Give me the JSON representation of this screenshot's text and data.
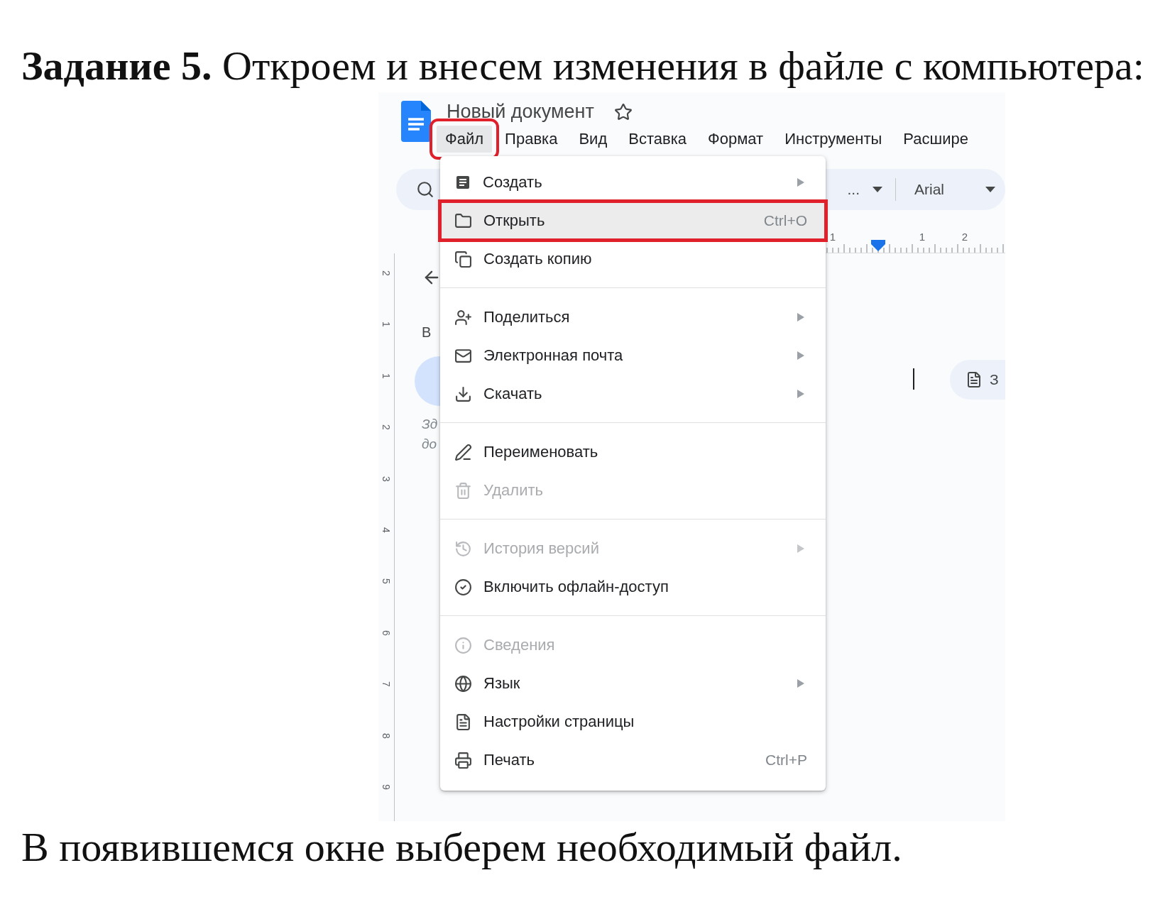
{
  "task": {
    "heading": "**Задание 5.** Откроем и внесем изменения в файле с компьютера:",
    "footer": "В появившемся окне выберем необходимый файл."
  },
  "screenshot": {
    "document_title": "Новый документ",
    "menu_bar": [
      {
        "label": "Файл",
        "selected": true,
        "outlined": true
      },
      {
        "label": "Правка",
        "selected": false,
        "outlined": false
      },
      {
        "label": "Вид",
        "selected": false,
        "outlined": false
      },
      {
        "label": "Вставка",
        "selected": false,
        "outlined": false
      },
      {
        "label": "Формат",
        "selected": false,
        "outlined": false
      },
      {
        "label": "Инструменты",
        "selected": false,
        "outlined": false
      },
      {
        "label": "Расшире",
        "selected": false,
        "outlined": false
      }
    ],
    "toolbar": {
      "style_dropdown": "...",
      "font_dropdown": "Arial"
    },
    "ruler_horizontal": [
      "1",
      "1",
      "2"
    ],
    "ruler_vertical": [
      "2",
      "1",
      "1",
      "2",
      "3",
      "4",
      "5",
      "6",
      "7",
      "8",
      "9"
    ],
    "outline_panel": {
      "heading": "В",
      "hint_lines": [
        "Зд",
        "до"
      ]
    },
    "chip": {
      "label": "З"
    },
    "file_menu": [
      {
        "kind": "item",
        "label": "Создать",
        "submenu": true,
        "disabled": false,
        "selected": false,
        "outlined": false
      },
      {
        "kind": "item",
        "label": "Открыть",
        "shortcut": "Ctrl+O",
        "submenu": false,
        "disabled": false,
        "selected": true,
        "outlined": true
      },
      {
        "kind": "item",
        "label": "Создать копию",
        "submenu": false,
        "disabled": false,
        "selected": false,
        "outlined": false
      },
      {
        "kind": "separator"
      },
      {
        "kind": "item",
        "label": "Поделиться",
        "submenu": true,
        "disabled": false,
        "selected": false,
        "outlined": false
      },
      {
        "kind": "item",
        "label": "Электронная почта",
        "submenu": true,
        "disabled": false,
        "selected": false,
        "outlined": false
      },
      {
        "kind": "item",
        "label": "Скачать",
        "submenu": true,
        "disabled": false,
        "selected": false,
        "outlined": false
      },
      {
        "kind": "separator"
      },
      {
        "kind": "item",
        "label": "Переименовать",
        "submenu": false,
        "disabled": false,
        "selected": false,
        "outlined": false
      },
      {
        "kind": "item",
        "label": "Удалить",
        "submenu": false,
        "disabled": true,
        "selected": false,
        "outlined": false
      },
      {
        "kind": "separator"
      },
      {
        "kind": "item",
        "label": "История версий",
        "submenu": true,
        "disabled": true,
        "selected": false,
        "outlined": false
      },
      {
        "kind": "item",
        "label": "Включить офлайн-доступ",
        "submenu": false,
        "disabled": false,
        "selected": false,
        "outlined": false
      },
      {
        "kind": "separator"
      },
      {
        "kind": "item",
        "label": "Сведения",
        "submenu": false,
        "disabled": true,
        "selected": false,
        "outlined": false
      },
      {
        "kind": "item",
        "label": "Язык",
        "submenu": true,
        "disabled": false,
        "selected": false,
        "outlined": false
      },
      {
        "kind": "item",
        "label": "Настройки страницы",
        "submenu": false,
        "disabled": false,
        "selected": false,
        "outlined": false
      },
      {
        "kind": "item",
        "label": "Печать",
        "shortcut": "Ctrl+P",
        "submenu": false,
        "disabled": false,
        "selected": false,
        "outlined": false
      }
    ]
  }
}
